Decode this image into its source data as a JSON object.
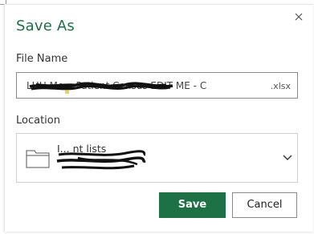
{
  "dialog": {
    "title": "Save As",
    "close_icon": "close-icon"
  },
  "file_name": {
    "label": "File Name",
    "value": "LHH Me... Patient Census EDIT ME - C",
    "extension": ".xlsx"
  },
  "location": {
    "label": "Location",
    "folder_name": "I... nt lists",
    "folder_path": "",
    "folder_icon": "folder-icon",
    "dropdown_icon": "chevron-down-icon"
  },
  "buttons": {
    "save_label": "Save",
    "cancel_label": "Cancel"
  },
  "colors": {
    "accent": "#1e7145",
    "button_text": "#ffffff"
  }
}
